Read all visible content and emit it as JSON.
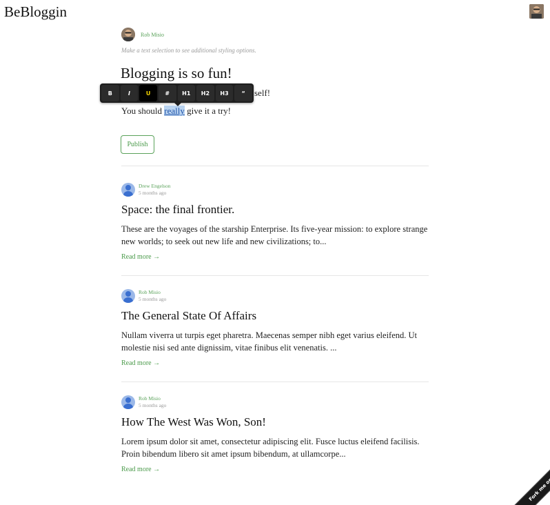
{
  "app": {
    "title": "BeBloggin"
  },
  "editor": {
    "author": "Rob Misio",
    "hint": "Make a text selection to see additional styling options.",
    "title": "Blogging is so fun!",
    "line1_visible": "self!",
    "line2_before": "You should ",
    "line2_selected": "really",
    "line2_after": " give it a try!",
    "publish_label": "Publish"
  },
  "toolbar": {
    "buttons": [
      "B",
      "I",
      "U",
      "#",
      "H1",
      "H2",
      "H3",
      "“"
    ],
    "active": "U",
    "active_color": "#f0d000"
  },
  "posts": [
    {
      "author": "Drew Engelson",
      "time": "5 months ago",
      "title": "Space: the final frontier.",
      "excerpt": "These are the voyages of the starship Enterprise. Its five-year mission: to explore strange new worlds; to seek out new life and new civilizations; to...",
      "read_more": "Read more →"
    },
    {
      "author": "Rob Misio",
      "time": "5 months ago",
      "title": "The General State Of Affairs",
      "excerpt": "Nullam viverra ut turpis eget pharetra. Maecenas semper nibh eget varius eleifend. Ut molestie nisi sed ante dignissim, vitae finibus elit venenatis. ...",
      "read_more": "Read more →"
    },
    {
      "author": "Rob Misio",
      "time": "5 months ago",
      "title": "How The West Was Won, Son!",
      "excerpt": "Lorem ipsum dolor sit amet, consectetur adipiscing elit. Fusce luctus eleifend facilisis. Proin bibendum libero sit amet ipsum bibendum, at ullamcorpe...",
      "read_more": "Read more →"
    }
  ],
  "ribbon": {
    "label": "Fork me on GitHub"
  },
  "colors": {
    "accent": "#5aa25a",
    "selection": "#b9d3f0"
  }
}
